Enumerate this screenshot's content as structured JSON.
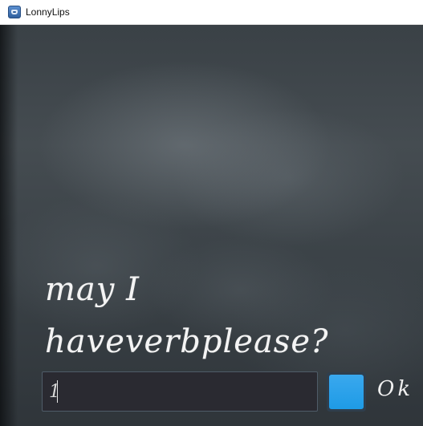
{
  "window": {
    "title": "LonnyLips",
    "icon": "app-icon"
  },
  "prompt": {
    "line1": "may I",
    "line2": "haveverbplease?"
  },
  "answer": {
    "value": "1",
    "placeholder": ""
  },
  "ok": {
    "label": "Ok",
    "checked": true,
    "color": "#1e9be6"
  },
  "colors": {
    "background": "#3d4449",
    "input_background": "#2a2a31",
    "text": "#f4f4f4"
  }
}
